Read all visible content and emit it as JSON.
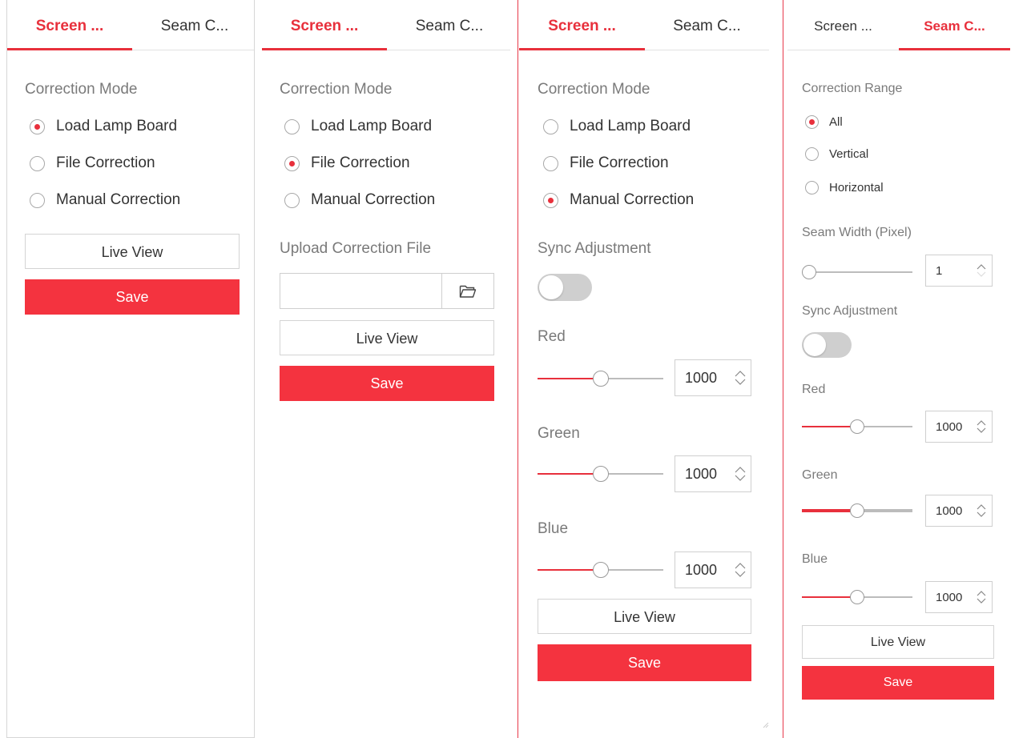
{
  "tabs": {
    "screen_correction": "Screen ...",
    "seam_correction": "Seam C..."
  },
  "screen_panel": {
    "correction_mode_label": "Correction Mode",
    "options": [
      "Load Lamp Board",
      "File Correction",
      "Manual Correction"
    ],
    "upload_label": "Upload Correction File",
    "upload_value": "",
    "sync_label": "Sync Adjustment",
    "sync_on": false,
    "red_label": "Red",
    "green_label": "Green",
    "blue_label": "Blue",
    "red_value": "1000",
    "green_value": "1000",
    "blue_value": "1000",
    "live_view": "Live View",
    "save": "Save"
  },
  "variants": [
    {
      "selected_mode": "Load Lamp Board"
    },
    {
      "selected_mode": "File Correction"
    },
    {
      "selected_mode": "Manual Correction"
    }
  ],
  "seam_panel": {
    "range_label": "Correction Range",
    "range_options": [
      "All",
      "Vertical",
      "Horizontal"
    ],
    "selected_range": "All",
    "seam_width_label": "Seam Width (Pixel)",
    "seam_width_value": "1",
    "seam_width_level": 0,
    "sync_label": "Sync Adjustment",
    "sync_on": false,
    "red_label": "Red",
    "green_label": "Green",
    "blue_label": "Blue",
    "red_value": "1000",
    "green_value": "1000",
    "blue_value": "1000",
    "live_view": "Live View",
    "save": "Save"
  },
  "slider_level_fraction": 0.5,
  "colors": {
    "accent": "#e8303c",
    "save_button": "#f4333f",
    "divider": "#e8394a",
    "toggle_off": "#cfcfcf"
  }
}
